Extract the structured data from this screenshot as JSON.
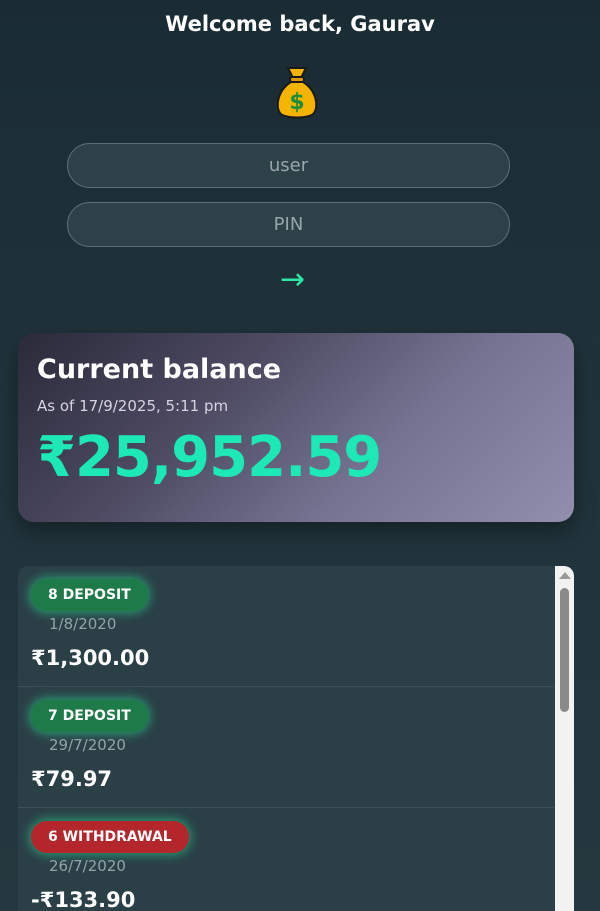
{
  "header": {
    "title": "Welcome back, Gaurav"
  },
  "login": {
    "user_placeholder": "user",
    "pin_placeholder": "PIN",
    "submit_symbol": "→"
  },
  "balance": {
    "title": "Current balance",
    "as_of": "As of 17/9/2025, 5:11 pm",
    "amount": "₹25,952.59"
  },
  "transactions": [
    {
      "badge": "8 DEPOSIT",
      "type": "deposit",
      "date": "1/8/2020",
      "amount": "₹1,300.00"
    },
    {
      "badge": "7 DEPOSIT",
      "type": "deposit",
      "date": "29/7/2020",
      "amount": "₹79.97"
    },
    {
      "badge": "6 WITHDRAWAL",
      "type": "withdrawal",
      "date": "26/7/2020",
      "amount": "-₹133.90"
    }
  ],
  "colors": {
    "accent": "#1de9b6",
    "deposit": "#1f7a4a",
    "withdrawal": "#b3262b"
  },
  "icons": {
    "logo": "money-bag-icon",
    "submit": "arrow-right-icon"
  }
}
